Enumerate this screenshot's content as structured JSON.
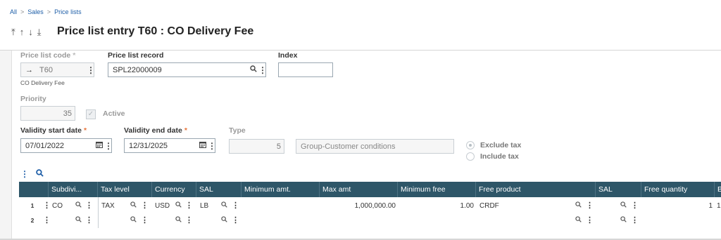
{
  "breadcrumb": {
    "items": [
      "All",
      "Sales",
      "Price lists"
    ],
    "separator": ">"
  },
  "nav_arrows": [
    "⤒",
    "↑",
    "↓",
    "⤓"
  ],
  "page": {
    "title": "Price list entry T60 : CO Delivery Fee"
  },
  "form": {
    "price_list_code": {
      "label": "Price list code",
      "required_mark": "*",
      "arrow": "→",
      "value": "T60",
      "description": "CO Delivery Fee"
    },
    "price_list_record": {
      "label": "Price list record",
      "value": "SPL22000009"
    },
    "index": {
      "label": "Index",
      "value": ""
    },
    "priority": {
      "label": "Priority",
      "value": "35"
    },
    "active": {
      "label": "Active",
      "checked": true
    },
    "validity_start": {
      "label": "Validity start date",
      "required_mark": "*",
      "value": "07/01/2022"
    },
    "validity_end": {
      "label": "Validity end date",
      "required_mark": "*",
      "value": "12/31/2025"
    },
    "type": {
      "label": "Type",
      "value": "5",
      "description": "Group-Customer conditions"
    },
    "tax_option": {
      "options": [
        "Exclude tax",
        "Include tax"
      ],
      "selected": "Exclude tax"
    }
  },
  "grid": {
    "columns": [
      "Subdivi...",
      "Tax level",
      "Currency",
      "SAL",
      "Minimum amt.",
      "Max amt",
      "Minimum free",
      "Free product",
      "SAL",
      "Free quantity",
      "B"
    ],
    "rows": [
      {
        "num": "1",
        "subdivision": "CO",
        "tax_level": "TAX",
        "currency": "USD",
        "sal": "LB",
        "minimum_amt": "",
        "max_amt": "1,000,000.00",
        "minimum_free": "1.00",
        "free_product": "CRDF",
        "sal2": "",
        "free_quantity": "1",
        "b": "1"
      },
      {
        "num": "2",
        "subdivision": "",
        "tax_level": "",
        "currency": "",
        "sal": "",
        "minimum_amt": "",
        "max_amt": "",
        "minimum_free": "",
        "free_product": "",
        "sal2": "",
        "free_quantity": "",
        "b": ""
      }
    ]
  },
  "icons": {
    "search": "search-icon",
    "menu": "more-vert-icon",
    "calendar": "calendar-icon",
    "checkmark": "checkmark-icon"
  },
  "colors": {
    "grid_header": "#2e5668",
    "link": "#1f5fa8",
    "required": "#e8743b"
  }
}
